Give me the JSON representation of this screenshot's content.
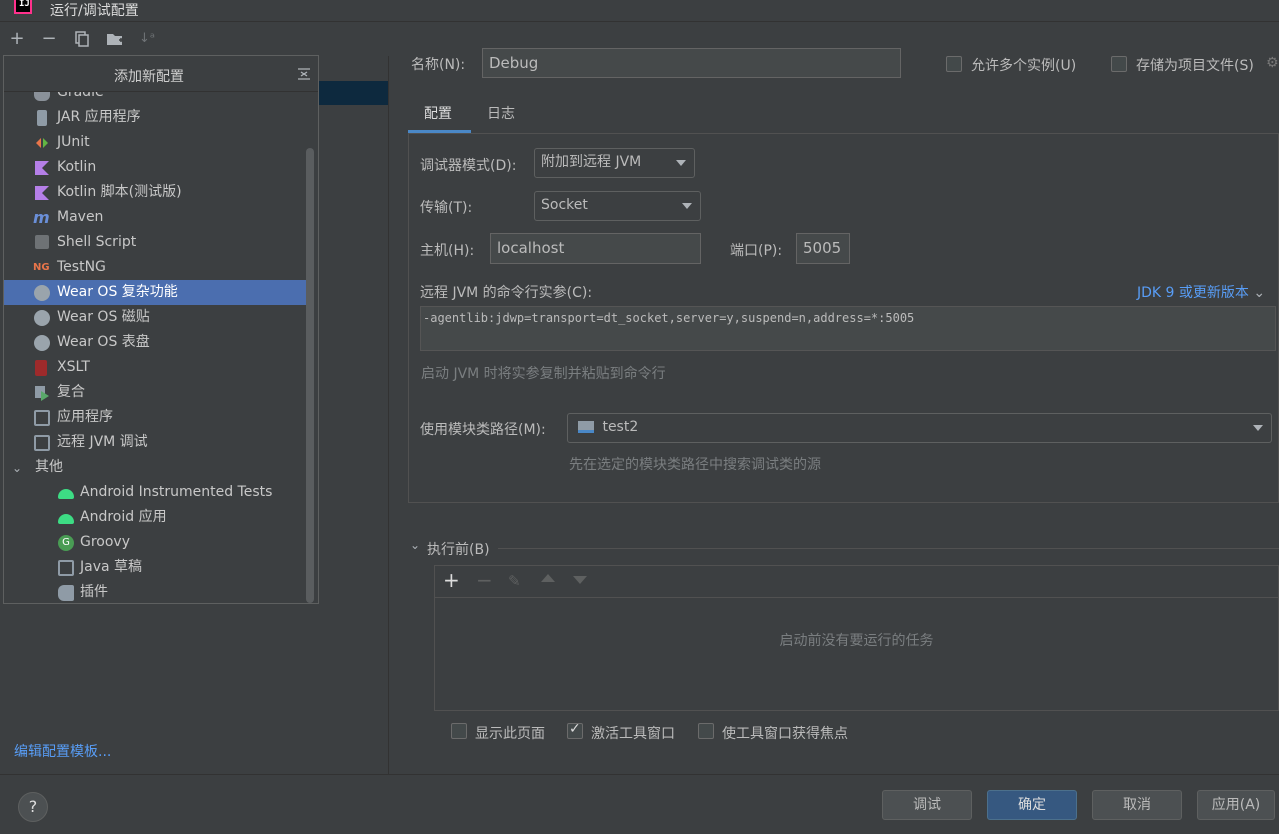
{
  "window": {
    "title": "运行/调试配置",
    "app_icon": "intellij-idea-icon"
  },
  "toolbar": {
    "buttons": [
      "add-icon",
      "remove-icon",
      "copy-icon",
      "folder-add-icon",
      "sort-icon"
    ]
  },
  "popup": {
    "title": "添加新配置",
    "items": [
      {
        "label": "Gradle",
        "icon": "gradle-icon",
        "indent": 0
      },
      {
        "label": "JAR 应用程序",
        "icon": "jar-icon",
        "indent": 0
      },
      {
        "label": "JUnit",
        "icon": "junit-icon",
        "indent": 0
      },
      {
        "label": "Kotlin",
        "icon": "kotlin-icon",
        "indent": 0
      },
      {
        "label": "Kotlin 脚本(测试版)",
        "icon": "kotlin-script-icon",
        "indent": 0
      },
      {
        "label": "Maven",
        "icon": "maven-icon",
        "indent": 0
      },
      {
        "label": "Shell Script",
        "icon": "shell-icon",
        "indent": 0
      },
      {
        "label": "TestNG",
        "icon": "testng-icon",
        "indent": 0
      },
      {
        "label": "Wear OS 复杂功能",
        "icon": "wear-complication-icon",
        "indent": 0,
        "selected": true
      },
      {
        "label": "Wear OS 磁贴",
        "icon": "wear-tile-icon",
        "indent": 0
      },
      {
        "label": "Wear OS 表盘",
        "icon": "wear-watchface-icon",
        "indent": 0
      },
      {
        "label": "XSLT",
        "icon": "xslt-icon",
        "indent": 0
      },
      {
        "label": "复合",
        "icon": "compound-icon",
        "indent": 0
      },
      {
        "label": "应用程序",
        "icon": "application-icon",
        "indent": 0
      },
      {
        "label": "远程 JVM 调试",
        "icon": "remote-jvm-icon",
        "indent": 0
      },
      {
        "label": "其他",
        "icon": "chevron-down-icon",
        "indent": 0,
        "group": true
      },
      {
        "label": "Android Instrumented Tests",
        "icon": "android-test-icon",
        "indent": 1
      },
      {
        "label": "Android 应用",
        "icon": "android-icon",
        "indent": 1
      },
      {
        "label": "Groovy",
        "icon": "groovy-icon",
        "indent": 1
      },
      {
        "label": "Java 草稿",
        "icon": "java-scratch-icon",
        "indent": 1
      },
      {
        "label": "插件",
        "icon": "plugin-icon",
        "indent": 1
      }
    ]
  },
  "edit_templates_link": "编辑配置模板...",
  "form": {
    "name_label": "名称(N):",
    "name_value": "Debug",
    "allow_multiple_label": "允许多个实例(U)",
    "store_as_file_label": "存储为项目文件(S)",
    "tabs": [
      "配置",
      "日志"
    ],
    "debugger_mode_label": "调试器模式(D):",
    "debugger_mode_value": "附加到远程 JVM",
    "transport_label": "传输(T):",
    "transport_value": "Socket",
    "host_label": "主机(H):",
    "host_value": "localhost",
    "port_label": "端口(P):",
    "port_value": "5005",
    "cmdline_label": "远程 JVM 的命令行实参(C):",
    "jdk_link": "JDK 9 或更新版本",
    "cmdline_value": "-agentlib:jdwp=transport=dt_socket,server=y,suspend=n,address=*:5005",
    "cmdline_hint": "启动 JVM 时将实参复制并粘贴到命令行",
    "module_label": "使用模块类路径(M):",
    "module_value": "test2",
    "module_hint": "先在选定的模块类路径中搜索调试类的源",
    "before_launch_label": "执行前(B)",
    "before_launch_empty": "启动前没有要运行的任务",
    "show_page_label": "显示此页面",
    "activate_window_label": "激活工具窗口",
    "focus_window_label": "使工具窗口获得焦点"
  },
  "buttons": {
    "debug": "调试",
    "ok": "确定",
    "cancel": "取消",
    "apply": "应用(A)"
  },
  "colors": {
    "accent": "#4b6eaf",
    "link": "#589df6",
    "primary_button": "#365880",
    "background": "#3c3f41"
  }
}
